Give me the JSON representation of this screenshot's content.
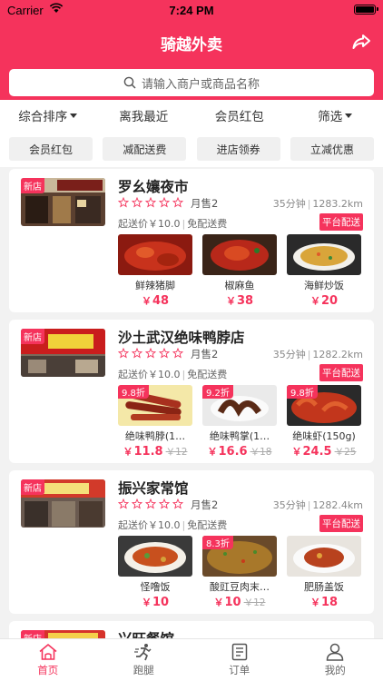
{
  "status": {
    "carrier": "Carrier",
    "time": "7:24 PM"
  },
  "header": {
    "title": "骑越外卖",
    "search_placeholder": "请输入商户或商品名称"
  },
  "filters": [
    {
      "label": "综合排序",
      "dropdown": true
    },
    {
      "label": "离我最近",
      "dropdown": false
    },
    {
      "label": "会员红包",
      "dropdown": false
    },
    {
      "label": "筛选",
      "dropdown": true
    }
  ],
  "chips": [
    "会员红包",
    "减配送费",
    "进店领券",
    "立减优惠"
  ],
  "stores": [
    {
      "tag": "新店",
      "name": "罗幺孃夜市",
      "monthly_sales": "月售2",
      "time": "35分钟",
      "distance": "1283.2km",
      "min_order": "起送价￥10.0",
      "delivery_fee": "免配送费",
      "delivery_badge": "平台配送",
      "rating_stars": 0,
      "dishes": [
        {
          "name": "鲜辣猪脚",
          "price": "48",
          "discount": "",
          "orig": ""
        },
        {
          "name": "椒麻鱼",
          "price": "38",
          "discount": "",
          "orig": ""
        },
        {
          "name": "海鲜炒饭",
          "price": "20",
          "discount": "",
          "orig": ""
        }
      ]
    },
    {
      "tag": "新店",
      "name": "沙土武汉绝味鸭脖店",
      "monthly_sales": "月售2",
      "time": "35分钟",
      "distance": "1282.2km",
      "min_order": "起送价￥10.0",
      "delivery_fee": "免配送费",
      "delivery_badge": "平台配送",
      "rating_stars": 0,
      "dishes": [
        {
          "name": "绝味鸭脖(1…",
          "price": "11.8",
          "discount": "9.8折",
          "orig": "￥12"
        },
        {
          "name": "绝味鸭掌(1…",
          "price": "16.6",
          "discount": "9.2折",
          "orig": "￥18"
        },
        {
          "name": "绝味虾(150g)",
          "price": "24.5",
          "discount": "9.8折",
          "orig": "￥25"
        }
      ]
    },
    {
      "tag": "新店",
      "name": "振兴家常馆",
      "monthly_sales": "月售2",
      "time": "35分钟",
      "distance": "1282.4km",
      "min_order": "起送价￥10.0",
      "delivery_fee": "免配送费",
      "delivery_badge": "平台配送",
      "rating_stars": 0,
      "dishes": [
        {
          "name": "怪噜饭",
          "price": "10",
          "discount": "",
          "orig": ""
        },
        {
          "name": "酸豇豆肉末…",
          "price": "10",
          "discount": "8.3折",
          "orig": "￥12"
        },
        {
          "name": "肥肠盖饭",
          "price": "18",
          "discount": "",
          "orig": ""
        }
      ]
    },
    {
      "tag": "新店",
      "name": "兴旺餐馆",
      "monthly_sales": "",
      "time": "",
      "distance": "",
      "min_order": "",
      "delivery_fee": "",
      "delivery_badge": "",
      "rating_stars": 0,
      "dishes": []
    }
  ],
  "tabs": [
    {
      "label": "首页",
      "icon": "home-icon",
      "active": true
    },
    {
      "label": "跑腿",
      "icon": "runner-icon",
      "active": false
    },
    {
      "label": "订单",
      "icon": "order-icon",
      "active": false
    },
    {
      "label": "我的",
      "icon": "profile-icon",
      "active": false
    }
  ],
  "colors": {
    "brand": "#f5335c",
    "background": "#f2f2f2"
  },
  "yen": "￥"
}
